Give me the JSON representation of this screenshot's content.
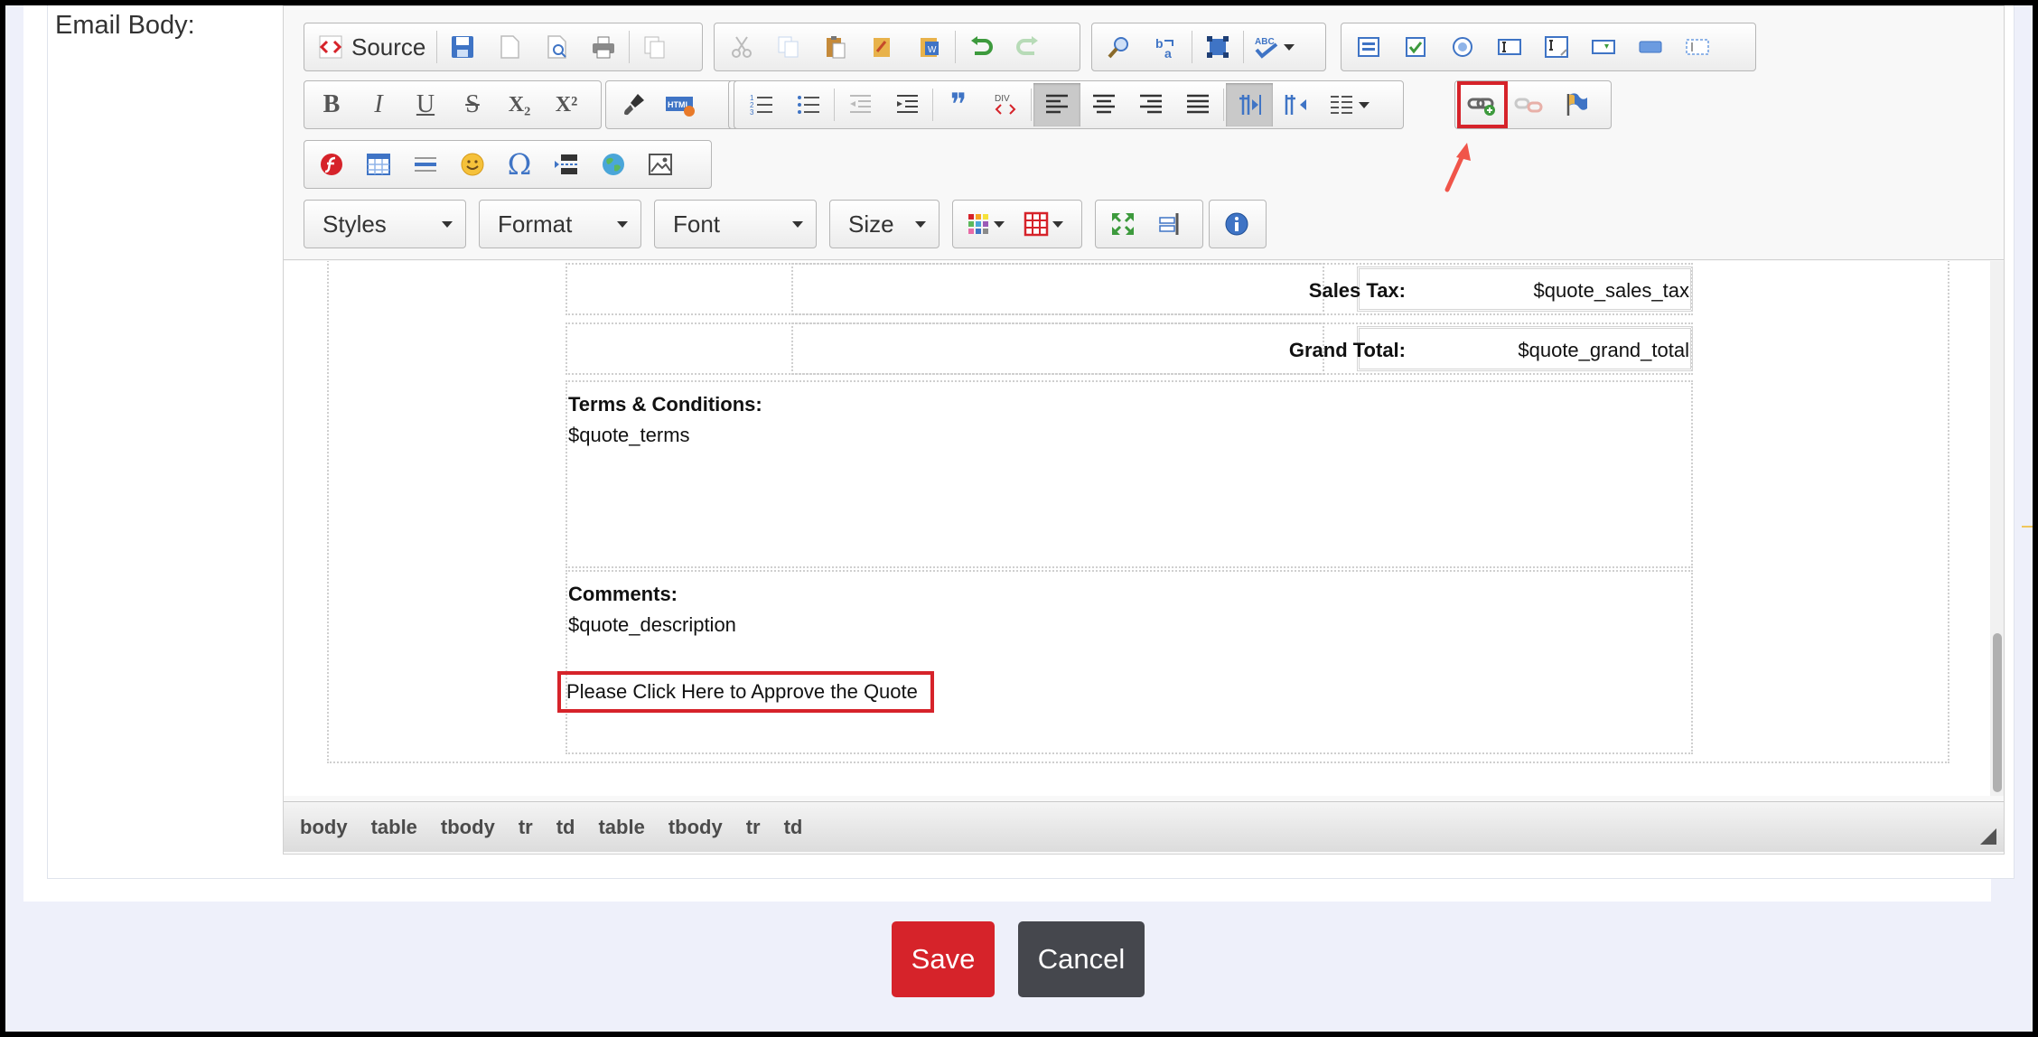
{
  "form": {
    "email_body_label": "Email Body:"
  },
  "toolbar": {
    "source_label": "Source",
    "styles_label": "Styles",
    "format_label": "Format",
    "font_label": "Font",
    "size_label": "Size",
    "bold_glyph": "B",
    "italic_glyph": "I",
    "underline_glyph": "U",
    "strike_glyph": "S",
    "subscript_glyph": "X₂",
    "superscript_glyph": "X²",
    "omega_glyph": "Ω",
    "quote_glyph": "❞",
    "div_glyph": "DIV",
    "html_glyph": "HTML",
    "abc_glyph": "ABC",
    "highlighted_button": "link-button",
    "accent_color": "#d6232a"
  },
  "content": {
    "sales_tax_label": "Sales Tax:",
    "sales_tax_value": "$quote_sales_tax",
    "grand_total_label": "Grand Total:",
    "grand_total_value": "$quote_grand_total",
    "terms_heading": "Terms & Conditions:",
    "terms_value": "$quote_terms",
    "comments_heading": "Comments:",
    "comments_value": "$quote_description",
    "approve_link_text": "Please Click Here to Approve the Quote"
  },
  "elements_path": [
    "body",
    "table",
    "tbody",
    "tr",
    "td",
    "table",
    "tbody",
    "tr",
    "td"
  ],
  "actions": {
    "save_label": "Save",
    "cancel_label": "Cancel",
    "save_color": "#d6232a",
    "cancel_color": "#45474d"
  }
}
